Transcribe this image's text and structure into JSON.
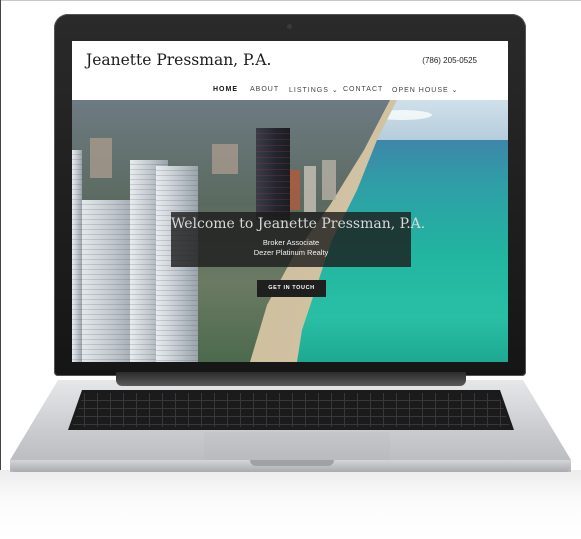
{
  "site": {
    "title": "Jeanette Pressman, P.A.",
    "phone": "(786) 205-0525"
  },
  "nav": {
    "home": "HOME",
    "about": "ABOUT",
    "listings": "LISTINGS ⌄",
    "contact": "CONTACT",
    "open_house": "OPEN HOUSE ⌄"
  },
  "hero": {
    "welcome": "Welcome to Jeanette Pressman, P.A.",
    "line1": "Broker Associate",
    "line2": "Dezer Platinum Realty",
    "cta": "GET IN TOUCH"
  },
  "colors": {
    "ocean": "#22b4a0",
    "header_bg": "#ffffff",
    "cta_bg": "#1f1f1f"
  }
}
